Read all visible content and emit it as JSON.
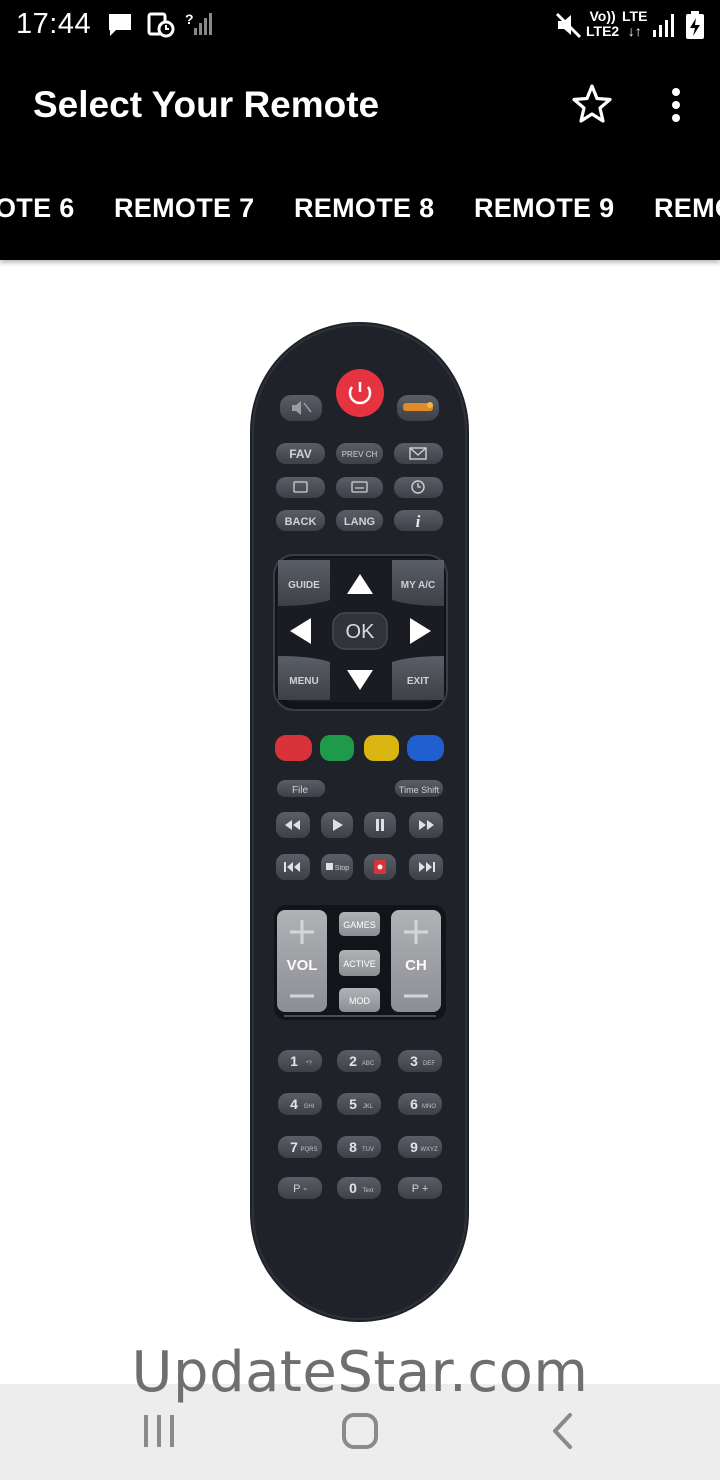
{
  "status_bar": {
    "time": "17:44",
    "volte_top": "Vo))",
    "volte_bottom": "LTE2",
    "lte_top": "LTE",
    "lte_bottom": "↓↑",
    "icons": [
      "message-icon",
      "clock-alarm-icon",
      "signal-question-icon",
      "mute-icon",
      "signal-icon",
      "battery-icon"
    ]
  },
  "app_bar": {
    "title": "Select Your Remote",
    "icons": [
      "star-icon",
      "more-vert-icon"
    ]
  },
  "tabs": [
    "OTE 6",
    "REMOTE 7",
    "REMOTE 8",
    "REMOTE 9",
    "REMO"
  ],
  "remote": {
    "labels": {
      "fav": "FAV",
      "prev_ch": "PREV CH",
      "back": "BACK",
      "lang": "LANG",
      "info": "i",
      "guide": "GUIDE",
      "my_ac": "MY A/C",
      "ok": "OK",
      "menu": "MENU",
      "exit": "EXIT",
      "file": "File",
      "time_shift": "Time Shift",
      "stop": "Stop",
      "vol": "VOL",
      "ch": "CH",
      "games": "GAMES",
      "active": "ACTIVE",
      "mod": "MOD",
      "p_minus": "P -",
      "p_plus": "P +"
    },
    "colors": {
      "body": "#1f2229",
      "button": "#4b4f57",
      "power": "#e53340",
      "red": "#d8323a",
      "green": "#1f9a4a",
      "yellow": "#d9b511",
      "blue": "#1f5fcf",
      "rocker": "#a0a2a6",
      "rec": "#d8323a"
    },
    "numpad": [
      {
        "digit": "1",
        "sub": "*?"
      },
      {
        "digit": "2",
        "sub": "ABC"
      },
      {
        "digit": "3",
        "sub": "DEF"
      },
      {
        "digit": "4",
        "sub": "GHI"
      },
      {
        "digit": "5",
        "sub": "JKL"
      },
      {
        "digit": "6",
        "sub": "MNO"
      },
      {
        "digit": "7",
        "sub": "PQRS"
      },
      {
        "digit": "8",
        "sub": "TUV"
      },
      {
        "digit": "9",
        "sub": "WXYZ"
      },
      {
        "digit": "0",
        "sub": "Text"
      }
    ]
  },
  "watermark": "UpdateStar.com",
  "nav_bar": {
    "icons": [
      "recents-icon",
      "home-icon",
      "back-icon"
    ]
  }
}
